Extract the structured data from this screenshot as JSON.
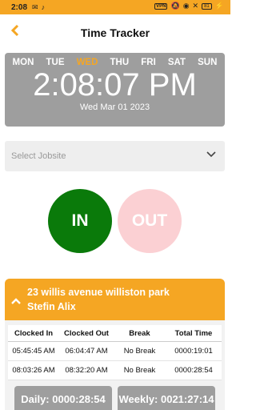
{
  "status": {
    "time": "2:08",
    "vpn": "VPN",
    "battery": "81"
  },
  "header": {
    "title": "Time Tracker"
  },
  "clock": {
    "days": [
      "MON",
      "TUE",
      "WED",
      "THU",
      "FRI",
      "SAT",
      "SUN"
    ],
    "active_day": "WED",
    "time": "2:08:07 PM",
    "date": "Wed Mar 01 2023"
  },
  "jobsite": {
    "placeholder": "Select Jobsite"
  },
  "actions": {
    "in_label": "IN",
    "out_label": "OUT"
  },
  "entry": {
    "address": "23 willis avenue williston park",
    "name": "Stefin Alix",
    "columns": [
      "Clocked In",
      "Clocked Out",
      "Break",
      "Total Time"
    ],
    "rows": [
      [
        "05:45:45 AM",
        "06:04:47 AM",
        "No Break",
        "0000:19:01"
      ],
      [
        "08:03:26 AM",
        "08:32:20 AM",
        "No Break",
        "0000:28:54"
      ]
    ],
    "daily": "Daily: 0000:28:54",
    "weekly": "Weekly: 0021:27:14"
  },
  "colors": {
    "accent": "#f5a623",
    "in": "#0a7a0a",
    "out": "#fbd0d3",
    "panel": "#9e9e9e"
  }
}
